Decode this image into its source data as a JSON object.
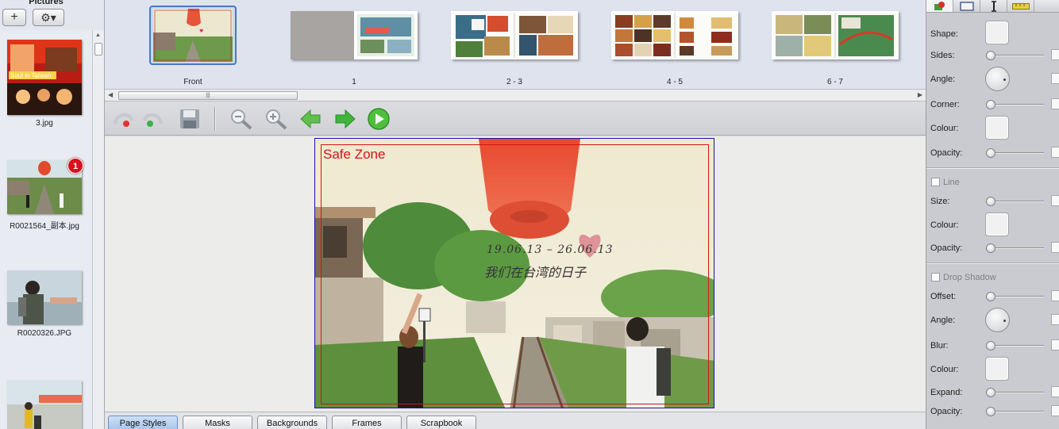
{
  "left_panel": {
    "title": "Pictures",
    "add_label": "+",
    "gear_label": "⚙▾",
    "pictures": [
      {
        "label": "3.jpg"
      },
      {
        "label": "R0021564_副本.jpg",
        "badge": "1"
      },
      {
        "label": "R0020326.JPG"
      },
      {
        "label": ""
      }
    ]
  },
  "page_strip": {
    "pages": [
      {
        "label": "Front",
        "selected": true
      },
      {
        "label": "1"
      },
      {
        "label": "2 - 3"
      },
      {
        "label": "4 - 5"
      },
      {
        "label": "6 - 7"
      }
    ],
    "scroll_grip": "|||"
  },
  "toolbar": {
    "icons": [
      "undo-icon",
      "redo-icon",
      "save-icon",
      "zoom-out-icon",
      "zoom-in-icon",
      "previous-page-icon",
      "next-page-icon",
      "play-icon"
    ]
  },
  "canvas": {
    "safe_zone_label": "Safe Zone",
    "photo_date": "19.06.13  –  26.06.13",
    "photo_caption": "我们在台湾的日子"
  },
  "bottom_tabs": [
    "Page Styles",
    "Masks",
    "Backgrounds",
    "Frames",
    "Scrapbook"
  ],
  "inspector": {
    "tab_icons": [
      "shape-tool-icon",
      "frame-tool-icon",
      "text-tool-icon",
      "ruler-tool-icon"
    ],
    "shape": {
      "shape_label": "Shape:",
      "sides_label": "Sides:",
      "angle_label": "Angle:",
      "corner_label": "Corner:",
      "colour_label": "Colour:",
      "opacity_label": "Opacity:"
    },
    "line": {
      "title": "Line",
      "size_label": "Size:",
      "colour_label": "Colour:",
      "opacity_label": "Opacity:"
    },
    "drop_shadow": {
      "title": "Drop Shadow",
      "offset_label": "Offset:",
      "angle_label": "Angle:",
      "blur_label": "Blur:",
      "colour_label": "Colour:",
      "expand_label": "Expand:",
      "opacity_label": "Opacity:"
    }
  },
  "colors": {
    "safe_zone": "#d21414",
    "page_border": "#1414a0",
    "selection": "#4a78c8"
  }
}
